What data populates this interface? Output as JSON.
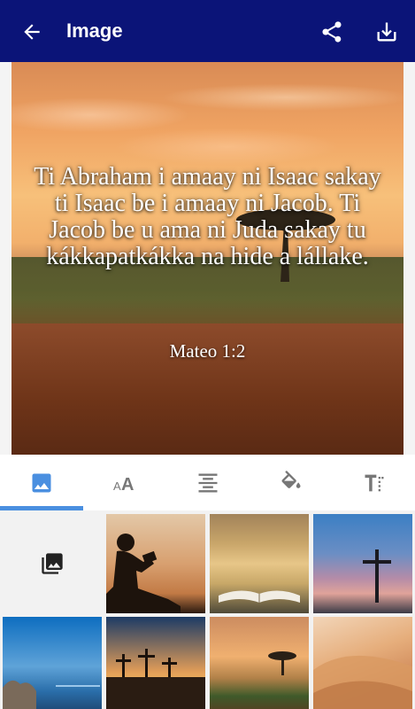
{
  "appbar": {
    "title": "Image",
    "back_icon": "arrow-back-icon",
    "share_icon": "share-icon",
    "download_icon": "download-icon",
    "background": "#0b1478"
  },
  "preview": {
    "verse_text": "Ti Abraham i amaay ni Isaac sakay ti Isaac be i amaay ni Jacob. Ti Jacob be u ama ni Juda sakay tu kákkapatkákka na hide a lállake.",
    "reference": "Mateo 1:2"
  },
  "tools": {
    "tabs": [
      {
        "icon": "image-icon",
        "selected": true
      },
      {
        "icon": "font-size-icon",
        "selected": false
      },
      {
        "icon": "align-center-icon",
        "selected": false
      },
      {
        "icon": "paint-bucket-icon",
        "selected": false
      },
      {
        "icon": "text-format-icon",
        "selected": false
      }
    ],
    "accent": "#4a8fe0"
  },
  "gallery": {
    "picker_icon": "photo-library-icon",
    "thumbnails": [
      "boy-reading-silhouette",
      "open-bible-bokeh",
      "cross-at-dusk",
      "coastal-rocks-sea",
      "three-crosses-sunset",
      "savanna-sunset-tree",
      "desert-dunes"
    ]
  }
}
